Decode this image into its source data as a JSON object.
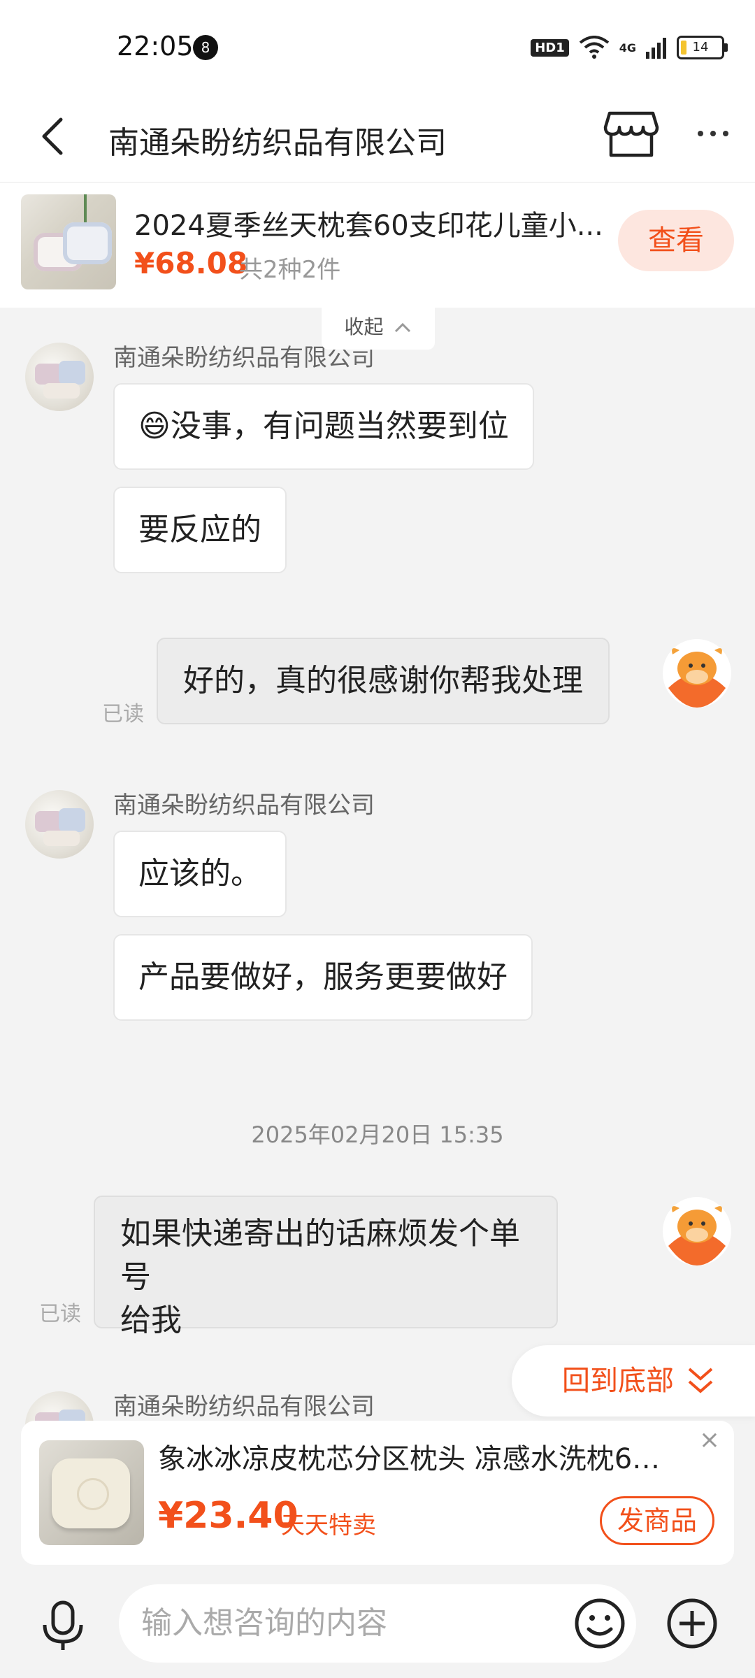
{
  "status": {
    "time": "22:05",
    "notif_count": "8",
    "hd": "HD1",
    "network": "4G",
    "battery": "14"
  },
  "header": {
    "title": "南通朵盼纺织品有限公司"
  },
  "product": {
    "title": "2024夏季丝天枕套60支印花儿童小...",
    "price": "¥68.08",
    "count": "共2种2件",
    "view_label": "查看",
    "collapse_label": "收起"
  },
  "messages": {
    "sender": "南通朵盼纺织品有限公司",
    "m1": "😄没事，有问题当然要到位",
    "m2": "要反应的",
    "m3": "好的，真的很感谢你帮我处理",
    "m4": "应该的。",
    "m5": "产品要做好，服务更要做好",
    "m6_line1": "如果快递寄出的话麻烦发个单号",
    "m6_line2": "给我",
    "read": "已读",
    "timestamp": "2025年02月20日 15:35"
  },
  "back_to_bottom": "回到底部",
  "recommend": {
    "title": "象冰冰凉皮枕芯分区枕头 凉感水洗枕60...",
    "price": "¥23.40",
    "tag": "天天特卖",
    "send_label": "发商品"
  },
  "input": {
    "placeholder": "输入想咨询的内容"
  },
  "icons": {
    "back": "back-arrow-icon",
    "shop": "store-icon",
    "more": "more-dots-icon",
    "mic": "microphone-icon",
    "emoji": "emoji-icon",
    "plus": "plus-icon",
    "close": "close-icon"
  },
  "colors": {
    "accent": "#f2501b",
    "background": "#f3f3f3",
    "bubble_out": "#ececec"
  }
}
